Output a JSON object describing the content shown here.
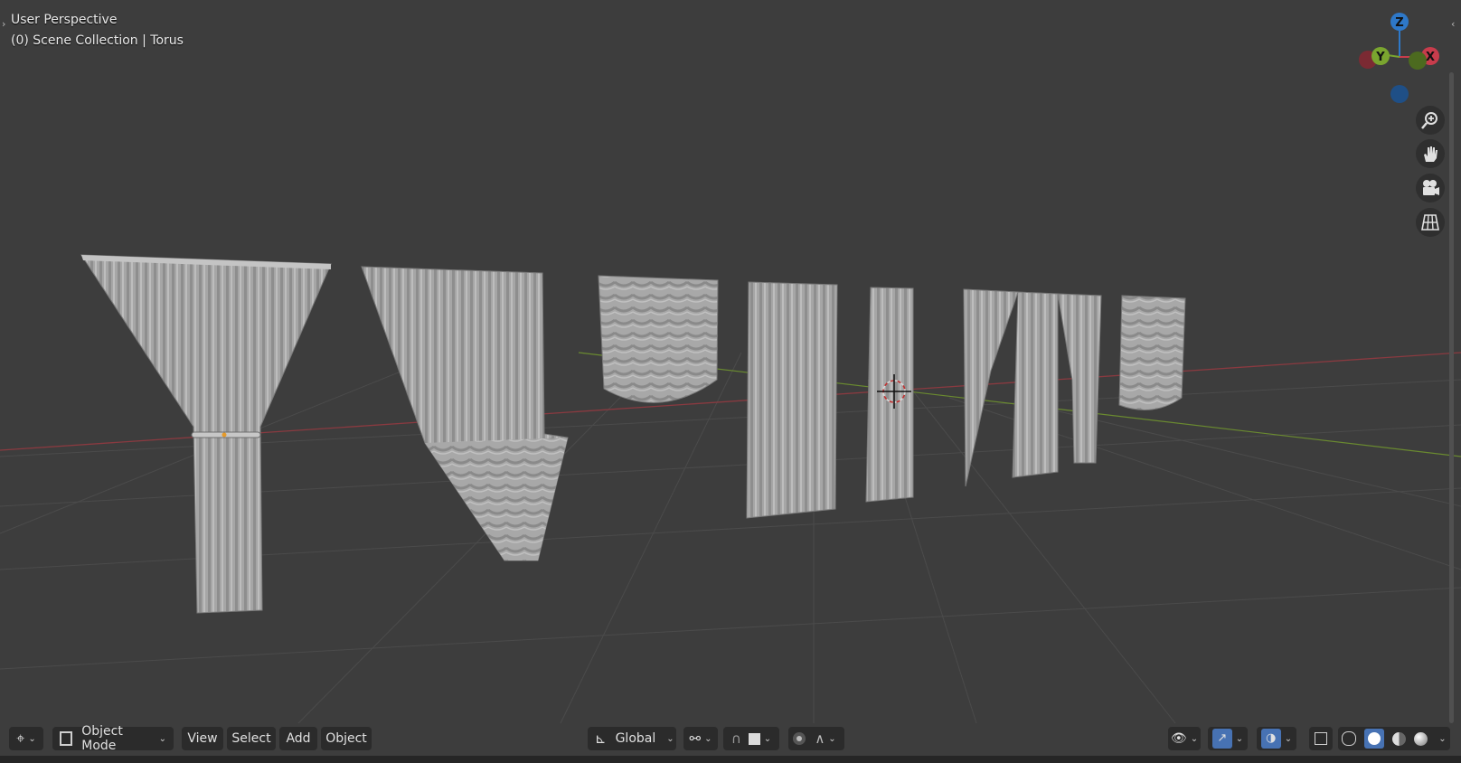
{
  "viewport": {
    "view_name": "User Perspective",
    "collection_info": "(0) Scene Collection | Torus"
  },
  "gizmo": {
    "axis_z": "Z",
    "axis_y": "Y",
    "axis_x": "X",
    "colors": {
      "x": "#c83c4c",
      "y": "#7aa52f",
      "z": "#2e78c8"
    }
  },
  "navigation": {
    "zoom_icon": "zoom-in-icon",
    "pan_icon": "hand-icon",
    "camera_icon": "camera-icon",
    "ortho_icon": "grid-icon"
  },
  "toolbar": {
    "editor_type_icon": "gizmo-icon",
    "mode_label": "Object Mode",
    "menu_view": "View",
    "menu_select": "Select",
    "menu_add": "Add",
    "menu_object": "Object",
    "orientation_label": "Global"
  },
  "scene_objects": [
    "curtain-tied-back",
    "curtain-swag-side",
    "valance-swag",
    "curtain-straight",
    "curtain-narrow",
    "curtain-double",
    "valance-small"
  ]
}
